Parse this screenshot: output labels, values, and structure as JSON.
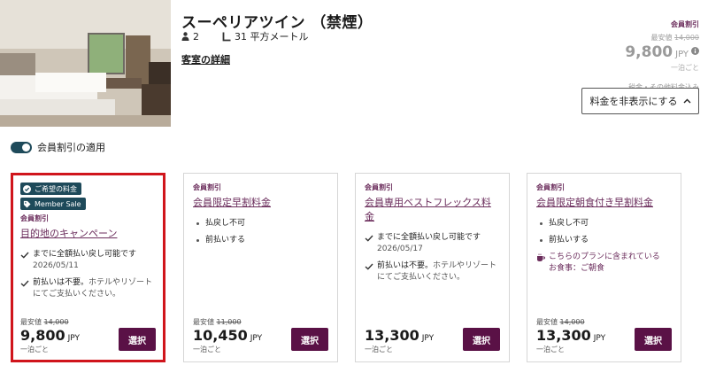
{
  "room": {
    "title": "スーペリアツイン （禁煙）",
    "occupancy": "2",
    "area": "31 平方メートル",
    "details_link": "客室の詳細"
  },
  "price_summary": {
    "member_label": "会員割引",
    "was_prefix": "最安値",
    "was_price": "14,000",
    "amount": "9,800",
    "currency": "JPY",
    "per_night": "一泊ごと",
    "taxes_note": "税金・その他料金込み"
  },
  "hide_price_button": {
    "label": "料金を非表示にする"
  },
  "member_toggle": {
    "label": "会員割引の適用",
    "on": true
  },
  "rates": [
    {
      "badges": [
        "ご希望の料金",
        "Member Sale"
      ],
      "member_label": "会員割引",
      "name": "目的地のキャンペーン",
      "features": [
        {
          "type": "check",
          "text": "までに全額払い戻し可能です",
          "sub": "2026/05/11"
        },
        {
          "type": "check",
          "text": "前払いは不要。",
          "sub": "ホテルやリゾートにてご支払いください。"
        }
      ],
      "was_prefix": "最安値",
      "was_price": "14,000",
      "amount": "9,800",
      "currency": "JPY",
      "per_night": "一泊ごと",
      "select_label": "選択"
    },
    {
      "badges": [],
      "member_label": "会員割引",
      "name": "会員限定早割料金",
      "features": [
        {
          "type": "dot",
          "text": "払戻し不可",
          "sub": ""
        },
        {
          "type": "dot",
          "text": "前払いする",
          "sub": ""
        }
      ],
      "was_prefix": "最安値",
      "was_price": "11,000",
      "amount": "10,450",
      "currency": "JPY",
      "per_night": "一泊ごと",
      "select_label": "選択"
    },
    {
      "badges": [],
      "member_label": "会員割引",
      "name": "会員専用ベストフレックス料金",
      "features": [
        {
          "type": "check",
          "text": "までに全額払い戻し可能です",
          "sub": "2026/05/17"
        },
        {
          "type": "check",
          "text": "前払いは不要。",
          "sub": "ホテルやリゾートにてご支払いください。"
        }
      ],
      "was_prefix": "",
      "was_price": "",
      "amount": "13,300",
      "currency": "JPY",
      "per_night": "一泊ごと",
      "select_label": "選択"
    },
    {
      "badges": [],
      "member_label": "会員割引",
      "name": "会員限定朝食付き早割料金",
      "features": [
        {
          "type": "dot",
          "text": "払戻し不可",
          "sub": ""
        },
        {
          "type": "dot",
          "text": "前払いする",
          "sub": ""
        },
        {
          "type": "meal",
          "text": "こちらのプランに含まれている",
          "sub": "お食事：ご朝食"
        }
      ],
      "was_prefix": "最安値",
      "was_price": "14,000",
      "amount": "13,300",
      "currency": "JPY",
      "per_night": "一泊ごと",
      "select_label": "選択"
    }
  ],
  "colors": {
    "brand_plum": "#6b2d5c",
    "button_plum": "#5a1146",
    "badge_teal": "#1e4a5a",
    "selected_outline": "#d0151c"
  }
}
